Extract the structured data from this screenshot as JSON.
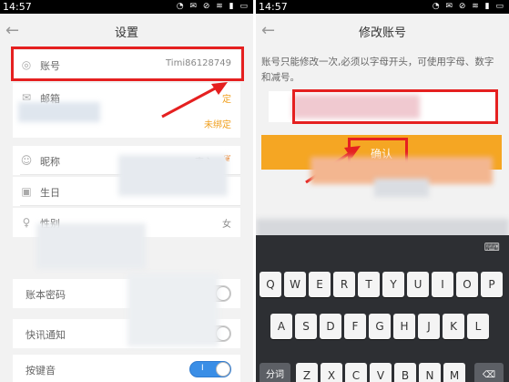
{
  "left": {
    "status": {
      "time": "14:57"
    },
    "title": "设置",
    "rows": [
      {
        "label": "账号",
        "value": "Timi86128749"
      },
      {
        "label": "邮箱",
        "value": "定"
      },
      {
        "label": "",
        "value": "未绑定"
      },
      {
        "label": "昵称",
        "value": "南心"
      },
      {
        "label": "生日",
        "value": ""
      },
      {
        "label": "性别",
        "value": "女"
      }
    ],
    "toggles": [
      {
        "label": "账本密码",
        "on": false
      },
      {
        "label": "快讯通知",
        "on": false
      },
      {
        "label": "按键音",
        "on": true
      }
    ]
  },
  "right": {
    "status": {
      "time": "14:57"
    },
    "title": "修改账号",
    "notice": "账号只能修改一次,必须以字母开头，可使用字母、数字和减号。",
    "confirm_label": "确认",
    "keyboard": {
      "row1": [
        "Q",
        "W",
        "E",
        "R",
        "T",
        "Y",
        "U",
        "I",
        "O",
        "P"
      ],
      "row2": [
        "A",
        "S",
        "D",
        "F",
        "G",
        "H",
        "J",
        "K",
        "L"
      ],
      "row3": [
        "Z",
        "X",
        "C",
        "V",
        "B",
        "N",
        "M"
      ],
      "mode_label": "分词"
    }
  },
  "accent_color": "#f5a623",
  "highlight_color": "#e52020"
}
